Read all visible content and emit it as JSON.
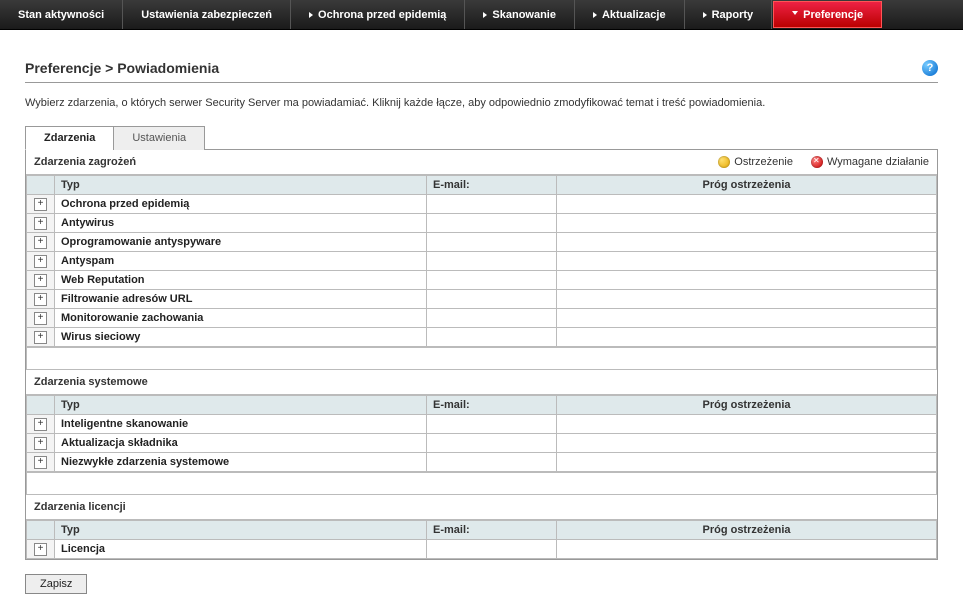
{
  "nav": {
    "items": [
      {
        "label": "Stan aktywności",
        "hasArrow": false
      },
      {
        "label": "Ustawienia zabezpieczeń",
        "hasArrow": false
      },
      {
        "label": "Ochrona przed epidemią",
        "hasArrow": true
      },
      {
        "label": "Skanowanie",
        "hasArrow": true
      },
      {
        "label": "Aktualizacje",
        "hasArrow": true
      },
      {
        "label": "Raporty",
        "hasArrow": true
      },
      {
        "label": "Preferencje",
        "hasArrow": true,
        "active": true
      }
    ]
  },
  "breadcrumb": "Preferencje > Powiadomienia",
  "instructions": "Wybierz zdarzenia, o których serwer Security Server ma powiadamiać. Kliknij każde łącze, aby odpowiednio zmodyfikować temat i treść powiadomienia.",
  "tabs": {
    "events": "Zdarzenia",
    "settings": "Ustawienia"
  },
  "legend": {
    "warning": "Ostrzeżenie",
    "action": "Wymagane działanie"
  },
  "columns": {
    "type": "Typ",
    "email": "E-mail:",
    "threshold": "Próg ostrzeżenia"
  },
  "sections": [
    {
      "title": "Zdarzenia zagrożeń",
      "showLegend": true,
      "rows": [
        {
          "type": "Ochrona przed epidemią"
        },
        {
          "type": "Antywirus"
        },
        {
          "type": "Oprogramowanie antyspyware"
        },
        {
          "type": "Antyspam"
        },
        {
          "type": "Web Reputation"
        },
        {
          "type": "Filtrowanie adresów URL"
        },
        {
          "type": "Monitorowanie zachowania"
        },
        {
          "type": "Wirus sieciowy"
        }
      ]
    },
    {
      "title": "Zdarzenia systemowe",
      "showLegend": false,
      "rows": [
        {
          "type": "Inteligentne skanowanie"
        },
        {
          "type": "Aktualizacja składnika"
        },
        {
          "type": "Niezwykłe zdarzenia systemowe"
        }
      ]
    },
    {
      "title": "Zdarzenia licencji",
      "showLegend": false,
      "rows": [
        {
          "type": "Licencja"
        }
      ]
    }
  ],
  "save": "Zapisz"
}
